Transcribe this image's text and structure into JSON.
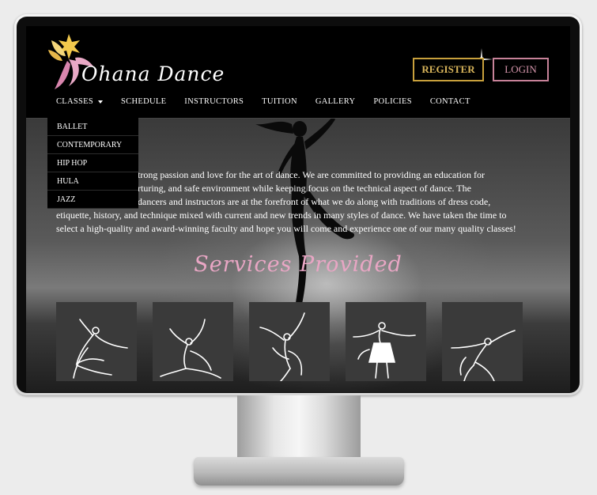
{
  "header": {
    "brand": "Ohana Dance",
    "register_label": "REGISTER",
    "login_label": "LOGIN"
  },
  "nav": {
    "items": [
      {
        "label": "CLASSES"
      },
      {
        "label": "SCHEDULE"
      },
      {
        "label": "INSTRUCTORS"
      },
      {
        "label": "TUITION"
      },
      {
        "label": "GALLERY"
      },
      {
        "label": "POLICIES"
      },
      {
        "label": "CONTACT"
      }
    ]
  },
  "dropdown": {
    "items": [
      "BALLET",
      "CONTEMPORARY",
      "HIP HOP",
      "HULA",
      "JAZZ"
    ]
  },
  "intro": {
    "lines": [
      "trong passion and love for the art of dance.  We are committed to providing an education for",
      "rturing, and safe environment while keeping focus on the technical aspect of dance.  The",
      "dancers and instructors are at the forefront of what we do along with traditions of dress code,",
      "etiquette, history, and technique mixed with current and new trends in many styles of dance. We have taken the time to",
      "select a high-quality and award-winning faculty and hope you will come and experience one of our many quality classes!"
    ]
  },
  "services": {
    "title": "Services Provided",
    "cards": [
      {
        "icon": "ballet-dancer-icon"
      },
      {
        "icon": "contemporary-dancer-icon"
      },
      {
        "icon": "hip-hop-dancer-icon"
      },
      {
        "icon": "hula-dancer-icon"
      },
      {
        "icon": "jazz-dancer-icon"
      }
    ]
  },
  "colors": {
    "register_border": "#c8a03c",
    "login_border": "#c78299",
    "title_pink": "#e8a6c4"
  }
}
